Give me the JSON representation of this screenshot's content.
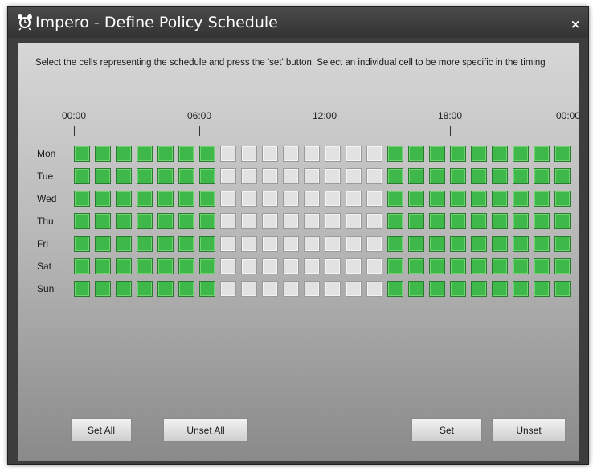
{
  "window": {
    "title": "Impero - Define Policy Schedule",
    "close_glyph": "×",
    "app_icon": "alarm-clock-icon"
  },
  "instruction": "Select the cells representing the schedule and press the 'set' button.  Select an individual cell to be more specific in the timing",
  "timeline": {
    "hours": [
      "00:00",
      "06:00",
      "12:00",
      "18:00",
      "00:00"
    ]
  },
  "schedule": {
    "days": [
      "Mon",
      "Tue",
      "Wed",
      "Thu",
      "Fri",
      "Sat",
      "Sun"
    ],
    "slots_per_day": 24,
    "set_hours": [
      0,
      1,
      2,
      3,
      4,
      5,
      6,
      15,
      16,
      17,
      18,
      19,
      20,
      21,
      22,
      23
    ],
    "colors": {
      "set": "#3fb84a",
      "unset": "#e2e2e2"
    }
  },
  "buttons": {
    "set_all": "Set All",
    "unset_all": "Unset All",
    "set": "Set",
    "unset": "Unset"
  }
}
